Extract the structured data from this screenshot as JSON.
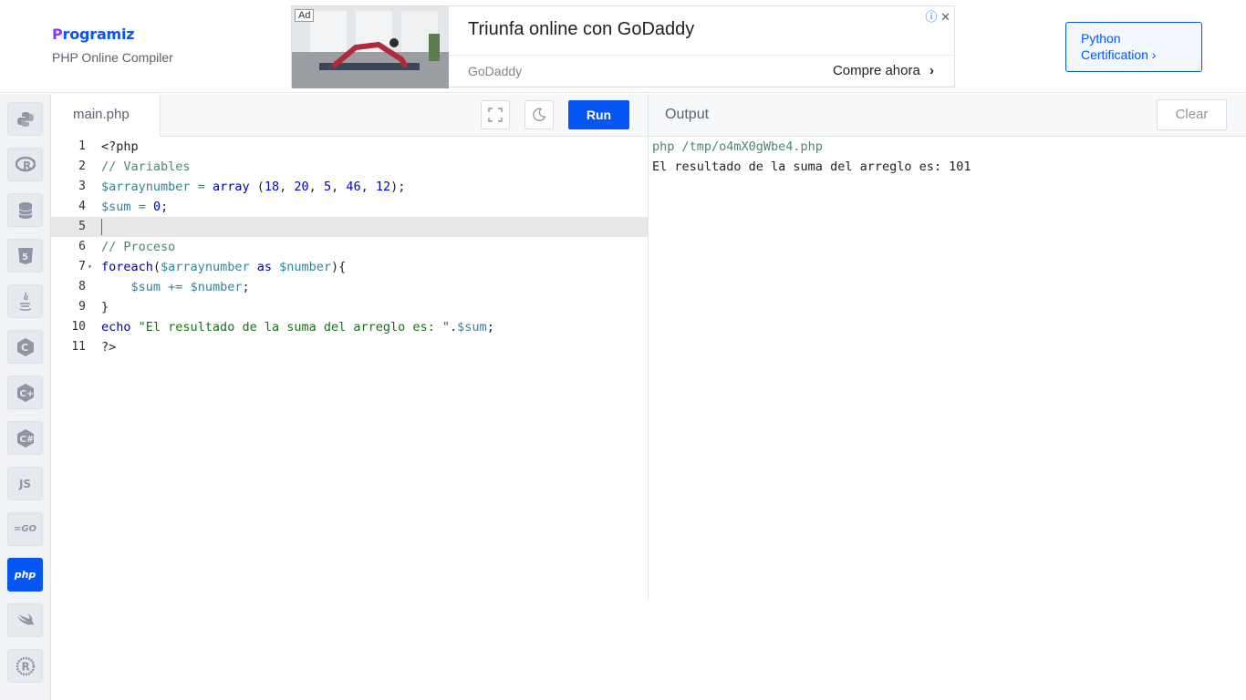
{
  "brand": {
    "name": "Programiz",
    "subtitle": "PHP Online Compiler"
  },
  "ad": {
    "tag": "Ad",
    "title": "Triunfa online con GoDaddy",
    "advertiser": "GoDaddy",
    "cta": "Compre ahora",
    "cta_arrow": "›"
  },
  "cert_button": {
    "line1": "Python",
    "line2": "Certification ›"
  },
  "sidebar": {
    "languages": [
      {
        "name": "python",
        "glyph": "py"
      },
      {
        "name": "r",
        "glyph": "R"
      },
      {
        "name": "sql",
        "glyph": "db"
      },
      {
        "name": "html",
        "glyph": "5"
      },
      {
        "name": "java",
        "glyph": "j"
      },
      {
        "name": "c",
        "glyph": "C"
      },
      {
        "name": "cpp",
        "glyph": "C+"
      },
      {
        "name": "csharp",
        "glyph": "C#"
      },
      {
        "name": "javascript",
        "glyph": "JS"
      },
      {
        "name": "go",
        "glyph": "GO"
      },
      {
        "name": "php",
        "glyph": "php",
        "active": true
      },
      {
        "name": "swift",
        "glyph": "sw"
      },
      {
        "name": "rust",
        "glyph": "R"
      }
    ]
  },
  "editor": {
    "tab": "main.php",
    "run_label": "Run",
    "active_line": 5,
    "lines": [
      {
        "n": "1",
        "html": "&lt;?php"
      },
      {
        "n": "2",
        "html": "<span class='k-com'>// Variables</span>"
      },
      {
        "n": "3",
        "html": "<span class='k-var'>$arraynumber</span> <span class='k-var'>=</span> <span class='k-kw'>array</span> (<span class='k-num'>18</span>, <span class='k-num'>20</span>, <span class='k-num'>5</span>, <span class='k-num'>46</span>, <span class='k-num'>12</span>);"
      },
      {
        "n": "4",
        "html": "<span class='k-var'>$sum</span> <span class='k-var'>=</span> <span class='k-num'>0</span>;"
      },
      {
        "n": "5",
        "html": ""
      },
      {
        "n": "6",
        "html": "<span class='k-com'>// Proceso</span>"
      },
      {
        "n": "7",
        "html": "<span class='k-kw'>foreach</span>(<span class='k-var'>$arraynumber</span> <span class='k-kw'>as</span> <span class='k-var'>$number</span>){",
        "fold": true
      },
      {
        "n": "8",
        "html": "    <span class='k-var'>$sum</span> <span class='k-var'>+=</span> <span class='k-var'>$number</span>;"
      },
      {
        "n": "9",
        "html": "}"
      },
      {
        "n": "10",
        "html": "<span class='k-kw'>echo</span> <span class='k-str'>\"El resultado de la suma del arreglo es: \"</span>.<span class='k-var'>$sum</span>;"
      },
      {
        "n": "11",
        "html": "?&gt;"
      }
    ]
  },
  "output": {
    "title": "Output",
    "clear_label": "Clear",
    "lines": [
      {
        "text": "php /tmp/o4mX0gWbe4.php",
        "color": "#4c886b"
      },
      {
        "text": "El resultado de la suma del arreglo es: 101",
        "color": "#222222"
      }
    ]
  }
}
